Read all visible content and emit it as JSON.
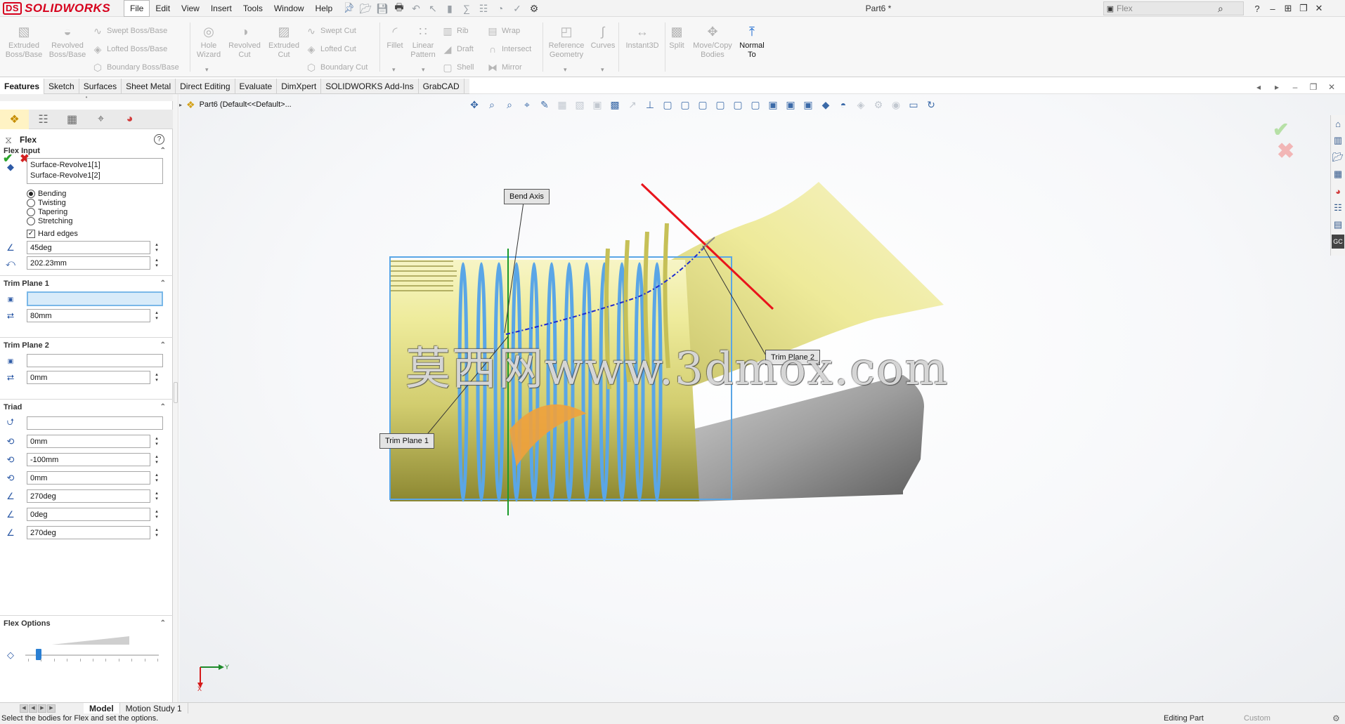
{
  "app": {
    "brand": "SOLIDWORKS",
    "brand_color": "#d6001c",
    "doc_title": "Part6 *"
  },
  "menu": {
    "items": [
      "File",
      "Edit",
      "View",
      "Insert",
      "Tools",
      "Window",
      "Help"
    ]
  },
  "search": {
    "value": "Flex"
  },
  "command_manager": {
    "extruded_boss": "Extruded\nBoss/Base",
    "revolved_boss": "Revolved\nBoss/Base",
    "swept_boss": "Swept Boss/Base",
    "lofted_boss": "Lofted Boss/Base",
    "boundary_boss": "Boundary Boss/Base",
    "hole_wizard": "Hole\nWizard",
    "revolved_cut": "Revolved\nCut",
    "extruded_cut": "Extruded\nCut",
    "swept_cut": "Swept Cut",
    "lofted_cut": "Lofted Cut",
    "boundary_cut": "Boundary Cut",
    "fillet": "Fillet",
    "linear_pattern": "Linear\nPattern",
    "rib": "Rib",
    "draft": "Draft",
    "shell": "Shell",
    "wrap": "Wrap",
    "intersect": "Intersect",
    "mirror": "Mirror",
    "reference_geometry": "Reference\nGeometry",
    "curves": "Curves",
    "instant3d": "Instant3D",
    "split": "Split",
    "move_copy_bodies": "Move/Copy\nBodies",
    "normal_to": "Normal\nTo"
  },
  "tabs": [
    "Features",
    "Sketch",
    "Surfaces",
    "Sheet Metal",
    "Direct Editing",
    "Evaluate",
    "DimXpert",
    "SOLIDWORKS Add-Ins",
    "GrabCAD"
  ],
  "property_manager": {
    "title": "Flex",
    "help": "?",
    "flex_input": {
      "header": "Flex Input",
      "bodies": [
        "Surface-Revolve1[1]",
        "Surface-Revolve1[2]"
      ],
      "modes": [
        "Bending",
        "Twisting",
        "Tapering",
        "Stretching"
      ],
      "selected_mode": "Bending",
      "hard_edges_label": "Hard edges",
      "hard_edges": true,
      "angle": "45deg",
      "radius": "202.23mm"
    },
    "trim_plane_1": {
      "header": "Trim Plane 1",
      "selection": "",
      "offset": "80mm"
    },
    "trim_plane_2": {
      "header": "Trim Plane 2",
      "selection": "",
      "offset": "0mm"
    },
    "triad": {
      "header": "Triad",
      "selection": "",
      "x": "0mm",
      "y": "-100mm",
      "z": "0mm",
      "rot_x": "270deg",
      "rot_y": "0deg",
      "rot_z": "270deg"
    },
    "flex_options": {
      "header": "Flex Options",
      "accuracy_fraction": 0.1
    }
  },
  "graphics": {
    "breadcrumb": "Part6  (Default<<Default>...",
    "callouts": {
      "bend_axis": "Bend Axis",
      "trim_plane_1": "Trim Plane 1",
      "trim_plane_2": "Trim Plane 2"
    },
    "watermark": "莫西网www.3dmox.com",
    "triad_labels": {
      "y": "Y",
      "x": "X"
    }
  },
  "bottom_tabs": [
    "Model",
    "Motion Study 1"
  ],
  "status": {
    "message": "Select the bodies for Flex and set the options.",
    "mode": "Editing Part",
    "units": "Custom"
  },
  "colors": {
    "accent": "#1b6ad1",
    "ok": "#2aa32a",
    "cancel": "#d42020",
    "model_yellow": "#e8e58e",
    "selection_blue": "#5aa6e6",
    "trim_red": "#e8141c"
  }
}
